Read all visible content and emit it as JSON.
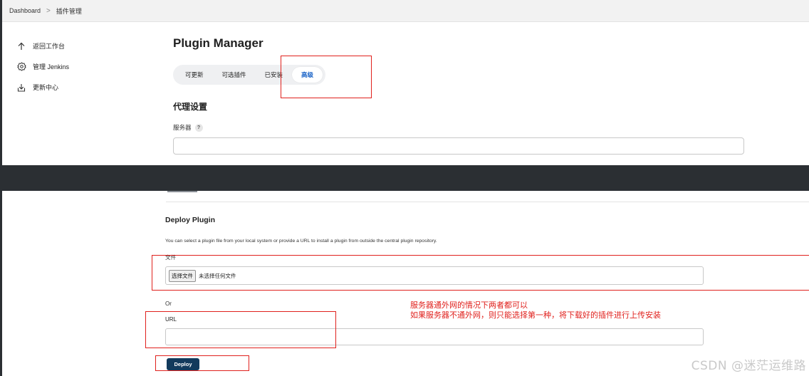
{
  "breadcrumb": {
    "root": "Dashboard",
    "separator": ">",
    "current": "插件管理"
  },
  "sidebar": {
    "items": [
      {
        "label": "返回工作台",
        "icon": "arrow-up-icon"
      },
      {
        "label": "管理 Jenkins",
        "icon": "gear-icon"
      },
      {
        "label": "更新中心",
        "icon": "download-icon"
      }
    ]
  },
  "main": {
    "title": "Plugin Manager",
    "tabs": [
      {
        "label": "可更新",
        "active": false
      },
      {
        "label": "可选插件",
        "active": false
      },
      {
        "label": "已安装",
        "active": false
      },
      {
        "label": "高级",
        "active": true
      }
    ],
    "proxy": {
      "title": "代理设置",
      "server_label": "服务器",
      "help": "?"
    }
  },
  "deploy": {
    "title": "Deploy Plugin",
    "description": "You can select a plugin file from your local system or provide a URL to install a plugin from outside the central plugin repository.",
    "file_label": "文件",
    "choose_file_button": "选择文件",
    "no_file": "未选择任何文件",
    "or": "Or",
    "url_label": "URL",
    "deploy_button": "Deploy"
  },
  "annotation": {
    "line1": "服务器通外网的情况下两者都可以",
    "line2": "如果服务器不通外网，则只能选择第一种，将下载好的插件进行上传安装"
  },
  "watermark": "CSDN @迷茫运维路",
  "colors": {
    "accent": "#1a63c7",
    "deploy_button": "#123a5c",
    "annotation": "#e0211d"
  }
}
